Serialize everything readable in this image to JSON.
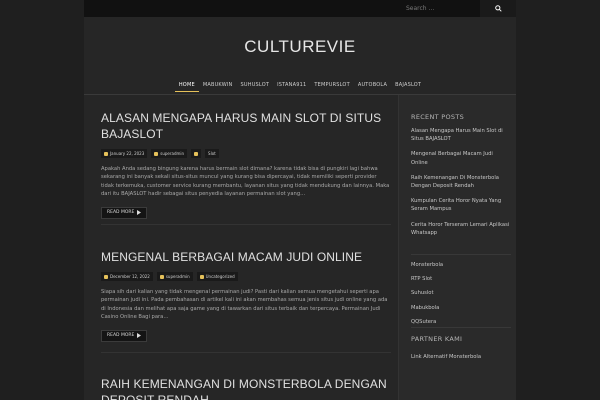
{
  "search": {
    "placeholder": "Search ..."
  },
  "site": {
    "title": "CULTUREVIE"
  },
  "nav": [
    "HOME",
    "MABUKWIN",
    "SUHUSLOT",
    "ISTANA911",
    "TEMPURSLOT",
    "AUTOBOLA",
    "BAJASLOT"
  ],
  "posts": [
    {
      "title": "ALASAN MENGAPA HARUS MAIN SLOT DI SITUS BAJASLOT",
      "date": "January 22, 2023",
      "author": "superadmin",
      "category": "Slot",
      "excerpt": "Apakah Anda sedang bingung karena harus bermain slot dimana? karena tidak bisa di pungkiri lagi bahwa sekarang ini banyak sekali situs-situs muncul yang kurang bisa dipercayai, tidak memiliki seperti provider tidak terkemuka, customer service kurang membantu, layanan situs yang tidak mendukung dan lainnya. Maka dari itu BAJASLOT hadir sebagai situs penyedia layanan permainan slot yang…",
      "read_more": "READ MORE"
    },
    {
      "title": "MENGENAL BERBAGAI MACAM JUDI ONLINE",
      "date": "December 12, 2022",
      "author": "superadmin",
      "category": "Uncategorized",
      "excerpt": "Siapa sih dari kalian yang tidak mengenal permainan judi? Pasti dari kalian semua mengetahui seperti apa permainan judi ini. Pada pembahasan di artikel kali ini akan membahas semua jenis situs judi online yang ada di Indonesia dan melihat apa saja game yang di tawarkan dari situs terbaik dan terpercaya. Permainan Judi Casino Online Bagi para…",
      "read_more": "READ MORE"
    },
    {
      "title": "RAIH KEMENANGAN DI MONSTERBOLA DENGAN DEPOSIT RENDAH"
    }
  ],
  "sidebar": {
    "recent_title": "RECENT POSTS",
    "recent": [
      "Alasan Mengapa Harus Main Slot di Situs BAJASLOT",
      "Mengenal Berbagai Macam Judi Online",
      "Raih Kemenangan Di Monsterbola Dengan Deposit Rendah",
      "Kumpulan Cerita Horor Nyata Yang Seram Mampus",
      "Cerita Horor Terseram Lemari Aplikasi Whatsapp"
    ],
    "links": [
      "Monsterbola",
      "RTP Slot",
      "Suhuslot",
      "Mabukbola",
      "QQSutera"
    ],
    "partner_title": "PARTNER KAMI",
    "partner_links": [
      "Link Alternatif Monsterbola"
    ]
  },
  "colors": {
    "accent": "#e5c15a",
    "background": "#1f1f1f",
    "panel": "#262626"
  }
}
